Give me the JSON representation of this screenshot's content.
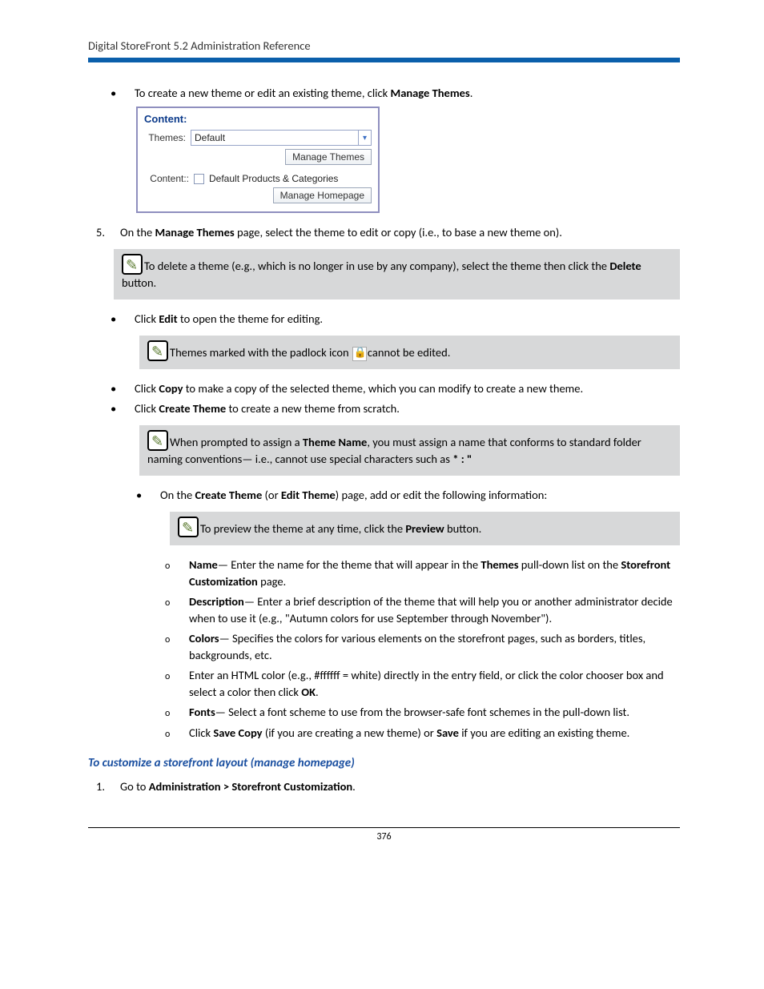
{
  "header": {
    "title": "Digital StoreFront 5.2 Administration Reference"
  },
  "step4": {
    "bullet1_pre": "To create a new theme or edit an existing theme, click ",
    "bullet1_bold": "Manage Themes",
    "bullet1_post": "."
  },
  "screenshot": {
    "title": "Content:",
    "themes_label": "Themes:",
    "themes_value": "Default",
    "manage_themes_btn": "Manage Themes",
    "content_label": "Content::",
    "content_value": "Default Products & Categories",
    "manage_homepage_btn": "Manage Homepage"
  },
  "step5": {
    "num": "5.",
    "text_pre": "On the ",
    "text_b1": "Manage Themes",
    "text_post": " page, select the theme to edit or copy (i.e., to base a new theme on)."
  },
  "note1": {
    "pre": "To delete a theme (e.g., which is no longer in use by any company), select the theme then click the ",
    "b1": "Delete",
    "post": " button."
  },
  "edit_bullet": {
    "pre": "Click ",
    "b1": "Edit",
    "post": " to open the theme for editing."
  },
  "note2": {
    "pre": "Themes marked with the padlock icon ",
    "post": "cannot be edited."
  },
  "copy_bullet": {
    "pre": "Click ",
    "b1": "Copy",
    "post": " to make a copy of the selected theme, which you can modify to create a new theme."
  },
  "create_bullet": {
    "pre": "Click ",
    "b1": "Create Theme",
    "post": " to create a new theme from scratch."
  },
  "note3": {
    "pre": "When prompted to assign a ",
    "b1": "Theme Name",
    "mid": ", you must assign a name that conforms to standard folder naming conventions— i.e., cannot use special characters such as ",
    "b2": "* : \""
  },
  "onthe_bullet": {
    "pre": "On the ",
    "b1": "Create Theme",
    "mid1": " (or ",
    "b2": "Edit Theme",
    "post": ") page, add or edit the following information:"
  },
  "note4": {
    "pre": "To preview the theme at any time, click the ",
    "b1": "Preview",
    "post": " button."
  },
  "sub": {
    "name": {
      "b1": "Name",
      "mid": "— Enter the name for the theme that will appear in the ",
      "b2": "Themes",
      "mid2": " pull-down list on the ",
      "b3": "Storefront Customization",
      "post": " page."
    },
    "desc": {
      "b1": "Description",
      "post": "— Enter a brief description of the theme that will help you or another administrator decide when to use it (e.g., \"Autumn colors for use September through November\")."
    },
    "colors": {
      "b1": "Colors",
      "post": "— Specifies the colors for various elements on the storefront pages, such as borders, titles, backgrounds, etc."
    },
    "htmlcolor": {
      "pre": "Enter an HTML color (e.g., #ffffff = white) directly in the entry field, or click the color chooser box and select a color then click ",
      "b1": "OK",
      "post": "."
    },
    "fonts": {
      "b1": "Fonts",
      "post": "— Select a font scheme to use from the browser-safe font schemes in the pull-down list."
    },
    "save": {
      "pre": "Click ",
      "b1": "Save Copy",
      "mid": " (if you are creating a new theme) or ",
      "b2": "Save",
      "post": " if you are editing an existing theme."
    }
  },
  "section_title": "To customize a storefront layout (manage homepage)",
  "step_admin": {
    "num": "1.",
    "pre": "Go to ",
    "b1": "Administration > Storefront Customization",
    "post": "."
  },
  "footer": {
    "page": "376"
  }
}
